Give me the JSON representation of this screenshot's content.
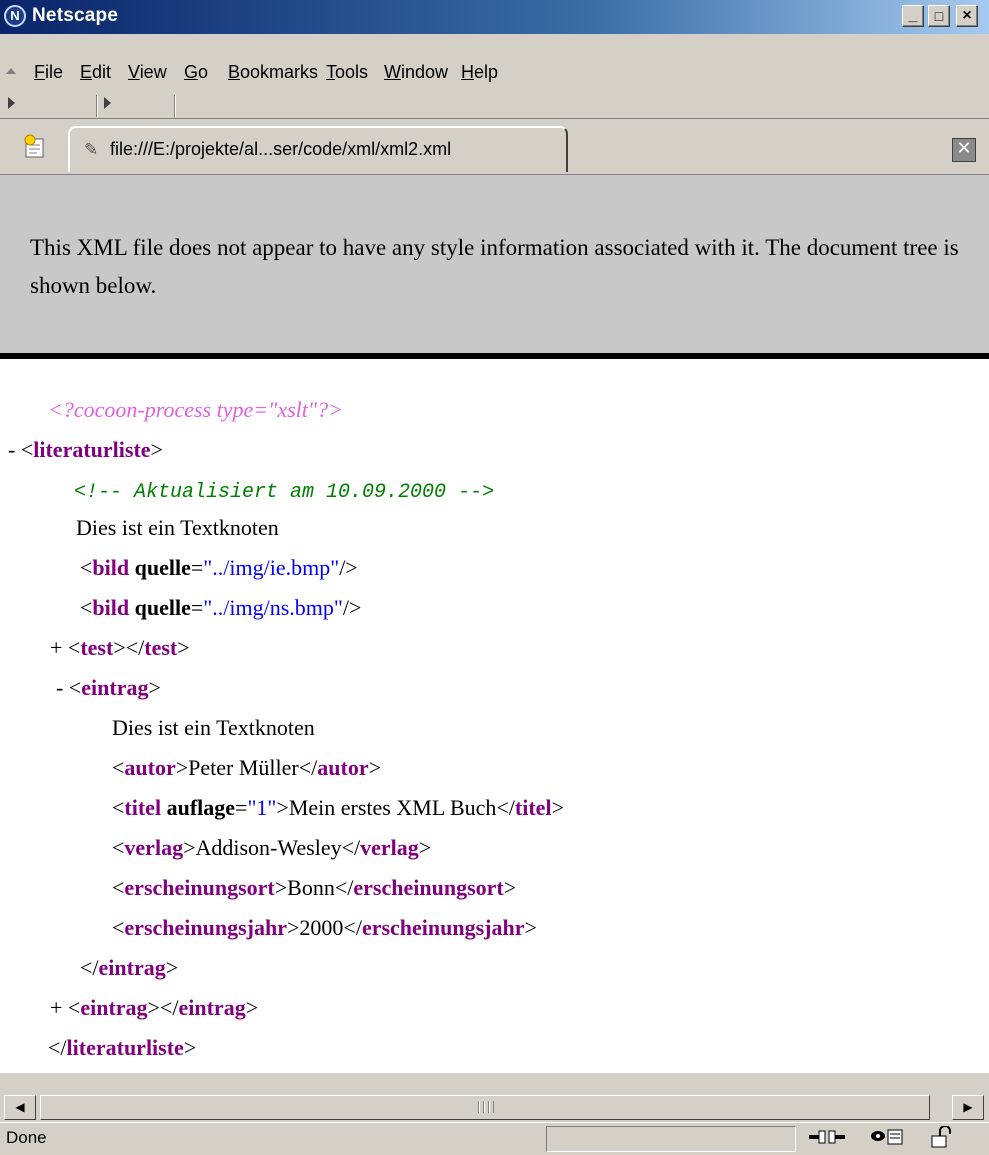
{
  "window": {
    "title": "Netscape",
    "logo_letter": "N",
    "buttons": {
      "minimize": "_",
      "maximize": "□",
      "close": "×"
    }
  },
  "menu": {
    "items": [
      {
        "label": "File",
        "underline": "F",
        "rest": "ile"
      },
      {
        "label": "Edit",
        "underline": "E",
        "rest": "dit"
      },
      {
        "label": "View",
        "underline": "V",
        "rest": "iew"
      },
      {
        "label": "Go",
        "underline": "G",
        "rest": "o"
      },
      {
        "label": "Bookmarks",
        "underline": "B",
        "rest": "ookmarks"
      },
      {
        "label": "Tools",
        "underline": "T",
        "rest": "ools"
      },
      {
        "label": "Window",
        "underline": "W",
        "rest": "indow"
      },
      {
        "label": "Help",
        "underline": "H",
        "rest": "elp"
      }
    ]
  },
  "tab": {
    "url": "file:///E:/projekte/al...ser/code/xml/xml2.xml",
    "close": "✕"
  },
  "notice": "This XML file does not appear to have any style information associated with it. The document tree is shown below.",
  "xml": {
    "pi": "<?cocoon-process type=\"xslt\"?>",
    "root_toggle": "-",
    "root_tag": "literaturliste",
    "comment": "<!-- Aktualisiert am 10.09.2000 -->",
    "text1": "Dies ist ein Textknoten",
    "bild_tag": "bild",
    "bild_attr": "quelle",
    "bild1_value": "\"../img/ie.bmp\"",
    "bild2_value": "\"../img/ns.bmp\"",
    "test_toggle": "+",
    "test_tag": "test",
    "eintrag_toggle": "-",
    "eintrag_tag": "eintrag",
    "eintrag_text": "Dies ist ein Textknoten",
    "autor_tag": "autor",
    "autor_value": "Peter Müller",
    "titel_tag": "titel",
    "titel_attr": "auflage",
    "titel_attr_value": "\"1\"",
    "titel_value": "Mein erstes XML Buch",
    "verlag_tag": "verlag",
    "verlag_value": "Addison-Wesley",
    "ort_tag": "erscheinungsort",
    "ort_value": "Bonn",
    "jahr_tag": "erscheinungsjahr",
    "jahr_value": "2000",
    "eintrag2_toggle": "+"
  },
  "status": {
    "text": "Done"
  }
}
